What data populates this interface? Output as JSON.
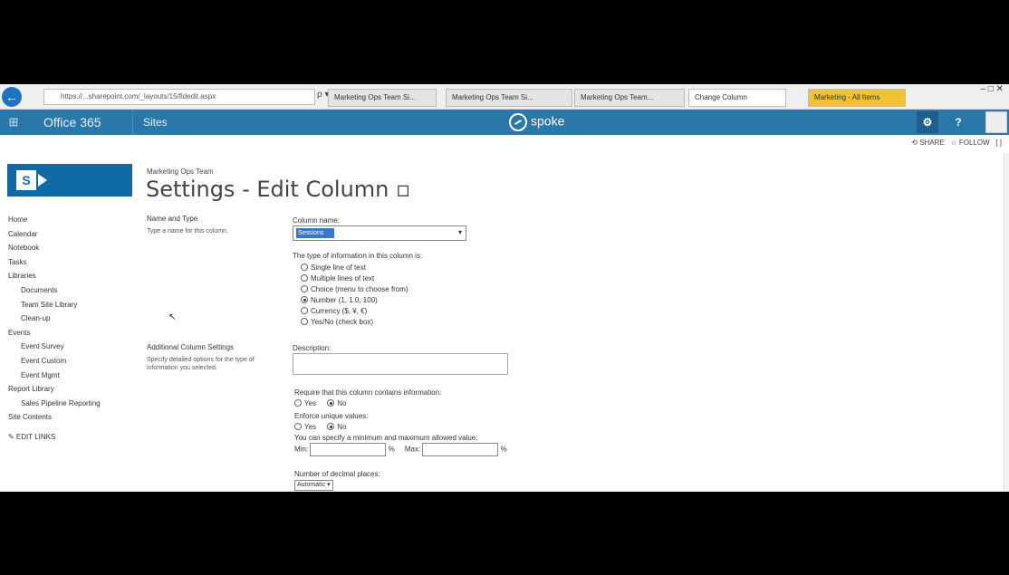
{
  "browser": {
    "address": "https://...sharepoint.com/_layouts/15/fldedit.aspx",
    "address_icons": "ρ ▾ 🔒 C",
    "tabs": [
      {
        "label": "Marketing Ops Team Si...",
        "style": "normal"
      },
      {
        "label": "Marketing Ops Team Si...",
        "style": "normal"
      },
      {
        "label": "Marketing Ops Team...",
        "style": "normal"
      },
      {
        "label": "Change Column",
        "style": "active"
      },
      {
        "label": "Marketing - All Items",
        "style": "ext"
      }
    ],
    "window_controls": "–  □  ✕"
  },
  "suite": {
    "waffle": "⊞",
    "product": "Office 365",
    "sites": "Sites",
    "brand": "spoke",
    "settings": "⚙",
    "help": "?"
  },
  "ribbon": {
    "share": "⟲ SHARE",
    "follow": "☆ FOLLOW",
    "focus": "[ ]"
  },
  "logo": {
    "letter": "S"
  },
  "breadcrumb": "Marketing Ops Team",
  "title": "Settings - Edit Column ▫",
  "leftnav": [
    {
      "label": "Home",
      "sub": false
    },
    {
      "label": "Calendar",
      "sub": false
    },
    {
      "label": "Notebook",
      "sub": false
    },
    {
      "label": "Tasks",
      "sub": false
    },
    {
      "label": "Libraries",
      "sub": false
    },
    {
      "label": "Documents",
      "sub": true
    },
    {
      "label": "Team Site Library",
      "sub": true
    },
    {
      "label": "Clean-up",
      "sub": true
    },
    {
      "label": "Events",
      "sub": false
    },
    {
      "label": "Event Survey",
      "sub": true
    },
    {
      "label": "Event Custom",
      "sub": true
    },
    {
      "label": "Event Mgmt",
      "sub": true
    },
    {
      "label": "Report Library",
      "sub": false
    },
    {
      "label": "Sales Pipeline Reporting",
      "sub": true
    },
    {
      "label": "Site Contents",
      "sub": false
    },
    {
      "label": "✎ EDIT LINKS",
      "sub": false
    }
  ],
  "form": {
    "name_type": {
      "title": "Name and Type",
      "desc": "Type a name for this column.",
      "column_name_label": "Column name:",
      "column_name_value": "Sessions",
      "type_label": "The type of information in this column is:",
      "types": [
        {
          "label": "Single line of text",
          "checked": false
        },
        {
          "label": "Multiple lines of text",
          "checked": false
        },
        {
          "label": "Choice (menu to choose from)",
          "checked": false
        },
        {
          "label": "Number (1, 1.0, 100)",
          "checked": true
        },
        {
          "label": "Currency ($, ¥, €)",
          "checked": false
        },
        {
          "label": "Yes/No (check box)",
          "checked": false
        }
      ]
    },
    "additional": {
      "title": "Additional Column Settings",
      "desc": "Specify detailed options for the type of information you selected.",
      "description_label": "Description:",
      "require_label": "Require that this column contains information:",
      "enforce_label": "Enforce unique values:",
      "yes": "Yes",
      "no": "No",
      "minmax_label": "You can specify a minimum and maximum allowed value:",
      "min": "Min:",
      "max": "Max:",
      "percent": "%",
      "decimals_label": "Number of decimal places:",
      "decimals_value": "Automatic ▾"
    }
  },
  "cursor": "↖"
}
